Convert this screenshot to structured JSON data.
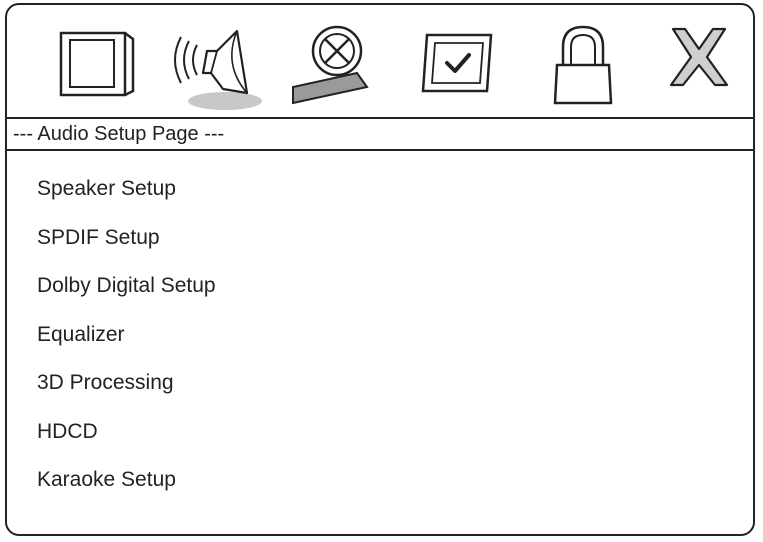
{
  "toolbar": {
    "icons": [
      {
        "name": "general-setup-icon",
        "active": false
      },
      {
        "name": "audio-setup-icon",
        "active": true
      },
      {
        "name": "video-setup-icon",
        "active": false
      },
      {
        "name": "preference-icon",
        "active": false
      },
      {
        "name": "password-lock-icon",
        "active": false
      },
      {
        "name": "exit-icon",
        "active": false
      }
    ]
  },
  "page": {
    "title": "--- Audio Setup Page ---"
  },
  "menu": {
    "items": [
      {
        "label": "Speaker Setup"
      },
      {
        "label": "SPDIF Setup"
      },
      {
        "label": "Dolby Digital Setup"
      },
      {
        "label": "Equalizer"
      },
      {
        "label": "3D Processing"
      },
      {
        "label": "HDCD"
      },
      {
        "label": "Karaoke Setup"
      }
    ]
  },
  "colors": {
    "line": "#222222",
    "highlight": "#c8c8c8",
    "icon_fill": "#ffffff",
    "tape_fill": "#9a9a9a",
    "exit_fill": "#cfcfcf"
  }
}
